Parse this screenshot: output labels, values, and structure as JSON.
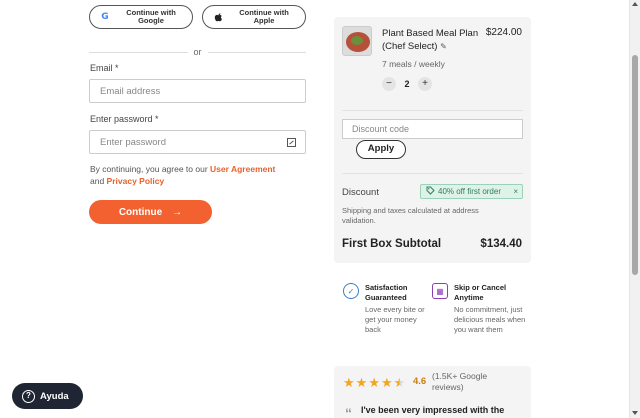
{
  "auth": {
    "google_label": "Continue with Google",
    "apple_label": "Continue with Apple",
    "or_text": "or",
    "email_label": "Email *",
    "email_placeholder": "Email address",
    "password_label": "Enter password *",
    "password_placeholder": "Enter password",
    "terms_prefix": "By continuing, you agree to our ",
    "terms_link": "User Agreement",
    "terms_and": "and ",
    "privacy_link": "Privacy Policy",
    "continue_label": "Continue",
    "continue_arrow": "→"
  },
  "summary": {
    "product_name": "Plant Based Meal Plan (Chef Select)",
    "product_price": "$224.00",
    "product_sub": "7 meals / weekly",
    "quantity": "2",
    "minus": "−",
    "plus": "+",
    "discount_placeholder": "Discount code",
    "apply_label": "Apply",
    "discount_label": "Discount",
    "discount_tag": "40% off first order",
    "discount_remove": "×",
    "shipping_note": "Shipping and taxes calculated at address validation.",
    "subtotal_label": "First Box Subtotal",
    "subtotal_value": "$134.40"
  },
  "guarantees": [
    {
      "title": "Satisfaction Guaranteed",
      "desc": "Love every bite or get your money back",
      "icon": "badge-check-icon",
      "color": "#3a7fc1"
    },
    {
      "title": "Skip or Cancel Anytime",
      "desc": "No commitment, just delicious meals when you want them",
      "icon": "calendar-icon",
      "color": "#8a3fb5"
    }
  ],
  "reviews": {
    "rating": "4.6",
    "count": "(1.5K+ Google reviews)",
    "quote": "I've been very impressed with the",
    "stars": 4.5
  },
  "help": {
    "label": "Ayuda"
  },
  "colors": {
    "accent": "#f2612f",
    "discount_green": "#2f7d5c",
    "star": "#f3a521"
  }
}
